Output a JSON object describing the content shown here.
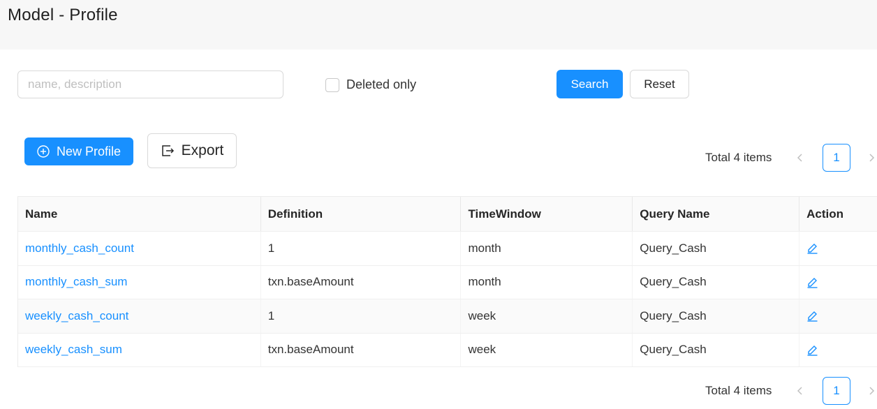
{
  "page": {
    "title": "Model - Profile"
  },
  "filters": {
    "search_placeholder": "name, description",
    "search_value": "",
    "deleted_only_label": "Deleted only",
    "deleted_only_checked": false,
    "search_label": "Search",
    "reset_label": "Reset"
  },
  "toolbar": {
    "new_profile_label": "New Profile",
    "export_label": "Export"
  },
  "pagination": {
    "total_text": "Total 4 items",
    "current_page": "1"
  },
  "table": {
    "columns": [
      "Name",
      "Definition",
      "TimeWindow",
      "Query Name",
      "Action"
    ],
    "rows": [
      {
        "name": "monthly_cash_count",
        "definition": "1",
        "time_window": "month",
        "query_name": "Query_Cash",
        "action_icon": "edit-icon"
      },
      {
        "name": "monthly_cash_sum",
        "definition": "txn.baseAmount",
        "time_window": "month",
        "query_name": "Query_Cash",
        "action_icon": "edit-icon"
      },
      {
        "name": "weekly_cash_count",
        "definition": "1",
        "time_window": "week",
        "query_name": "Query_Cash",
        "action_icon": "edit-icon"
      },
      {
        "name": "weekly_cash_sum",
        "definition": "txn.baseAmount",
        "time_window": "week",
        "query_name": "Query_Cash",
        "action_icon": "edit-icon"
      }
    ]
  },
  "colors": {
    "primary": "#1890ff",
    "header_bg": "#f7f7f7",
    "table_head_bg": "#fafafa"
  }
}
